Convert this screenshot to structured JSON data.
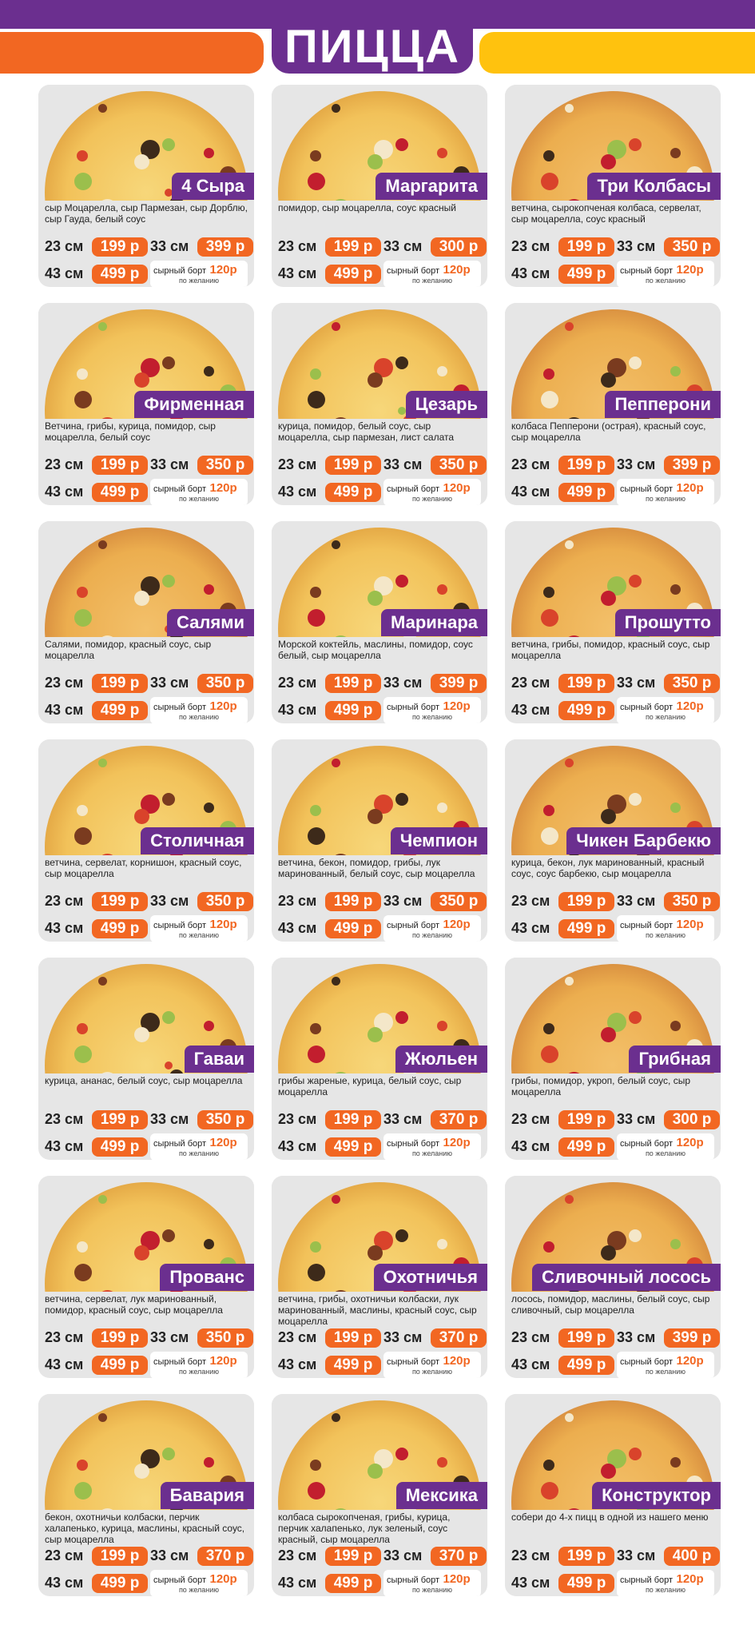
{
  "title": "ПИЦЦА",
  "colors": {
    "purple": "#6b2f8f",
    "orange": "#f26722",
    "yellow": "#ffc20e",
    "card_bg": "#e6e6e6"
  },
  "labels": {
    "size23": "23 см",
    "size33": "33 см",
    "size43": "43 см",
    "extra_label": "сырный борт",
    "extra_price": "120р",
    "extra_note": "по желанию"
  },
  "pizzas": [
    {
      "name": "4 Сыра",
      "desc": "сыр Моцарелла, сыр Пармезан, сыр Дорблю, сыр Гауда, белый соус",
      "p23": "199 р",
      "p33": "399 р",
      "p43": "499 р"
    },
    {
      "name": "Маргарита",
      "desc": "помидор, сыр моцарелла, соус красный",
      "p23": "199 р",
      "p33": "300 р",
      "p43": "499 р"
    },
    {
      "name": "Три Колбасы",
      "desc": "ветчина, сырокопченая колбаса, сервелат, сыр моцарелла, соус красный",
      "p23": "199 р",
      "p33": "350 р",
      "p43": "499 р"
    },
    {
      "name": "Фирменная",
      "desc": "Ветчина, грибы, курица, помидор, сыр моцарелла, белый соус",
      "p23": "199 р",
      "p33": "350 р",
      "p43": "499 р"
    },
    {
      "name": "Цезарь",
      "desc": "курица, помидор, белый соус, сыр моцарелла, сыр пармезан, лист салата",
      "p23": "199 р",
      "p33": "350 р",
      "p43": "499 р"
    },
    {
      "name": "Пепперони",
      "desc": "колбаса Пепперони (острая), красный соус, сыр моцарелла",
      "p23": "199 р",
      "p33": "399 р",
      "p43": "499 р"
    },
    {
      "name": "Салями",
      "desc": "Салями, помидор, красный соус, сыр моцарелла",
      "p23": "199 р",
      "p33": "350 р",
      "p43": "499 р"
    },
    {
      "name": "Маринара",
      "desc": "Морской коктейль, маслины, помидор, соус белый, сыр моцарелла",
      "p23": "199 р",
      "p33": "399 р",
      "p43": "499 р"
    },
    {
      "name": "Прошутто",
      "desc": "ветчина, грибы, помидор, красный соус, сыр моцарелла",
      "p23": "199 р",
      "p33": "350 р",
      "p43": "499 р"
    },
    {
      "name": "Столичная",
      "desc": "ветчина, сервелат, корнишон, красный соус, сыр моцарелла",
      "p23": "199 р",
      "p33": "350 р",
      "p43": "499 р"
    },
    {
      "name": "Чемпион",
      "desc": "ветчина, бекон, помидор, грибы, лук маринованный, белый соус, сыр моцарелла",
      "p23": "199 р",
      "p33": "350 р",
      "p43": "499 р"
    },
    {
      "name": "Чикен Барбекю",
      "desc": "курица, бекон, лук маринованный, красный соус, соус барбекю, сыр моцарелла",
      "p23": "199 р",
      "p33": "350 р",
      "p43": "499 р"
    },
    {
      "name": "Гаваи",
      "desc": "курица, ананас, белый соус, сыр моцарелла",
      "p23": "199 р",
      "p33": "350 р",
      "p43": "499 р"
    },
    {
      "name": "Жюльен",
      "desc": "грибы жареные, курица, белый соус, сыр моцарелла",
      "p23": "199 р",
      "p33": "370 р",
      "p43": "499 р"
    },
    {
      "name": "Грибная",
      "desc": "грибы, помидор, укроп, белый соус, сыр моцарелла",
      "p23": "199 р",
      "p33": "300 р",
      "p43": "499 р"
    },
    {
      "name": "Прованс",
      "desc": "ветчина, сервелат, лук маринованный, помидор, красный соус, сыр моцарелла",
      "p23": "199 р",
      "p33": "350 р",
      "p43": "499 р"
    },
    {
      "name": "Охотничья",
      "desc": "ветчина, грибы, охотничьи колбаски, лук маринованный, маслины, красный соус, сыр моцарелла",
      "p23": "199 р",
      "p33": "370 р",
      "p43": "499 р"
    },
    {
      "name": "Сливочный лосось",
      "desc": "лосось, помидор, маслины, белый соус, сыр сливочный, сыр моцарелла",
      "p23": "199 р",
      "p33": "399 р",
      "p43": "499 р"
    },
    {
      "name": "Бавария",
      "desc": "бекон, охотничьи колбаски, перчик халапенько, курица, маслины, красный соус, сыр моцарелла",
      "p23": "199 р",
      "p33": "370 р",
      "p43": "499 р"
    },
    {
      "name": "Мексика",
      "desc": "колбаса сырокопченая, грибы, курица, перчик халапенько, лук зеленый, соус красный, сыр моцарелла",
      "p23": "199 р",
      "p33": "370 р",
      "p43": "499 р"
    },
    {
      "name": "Конструктор",
      "desc": "собери до 4-х пицц в одной из нашего меню",
      "p23": "199 р",
      "p33": "400 р",
      "p43": "499 р"
    }
  ]
}
